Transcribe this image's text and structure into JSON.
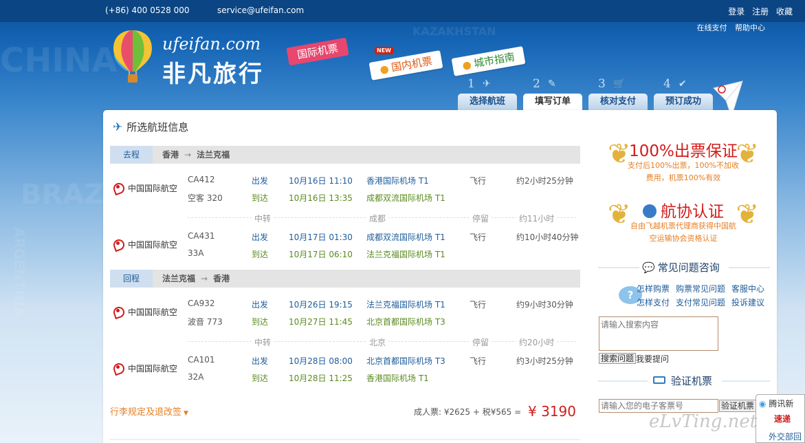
{
  "topbar": {
    "phone": "(+86) 400 0528 000",
    "email": "service@ufeifan.com",
    "links": [
      "登录",
      "注册",
      "收藏"
    ],
    "sublinks": [
      "在线支付",
      "帮助中心"
    ]
  },
  "logo": {
    "url": "ufeifan.com",
    "name": "非凡旅行"
  },
  "nav": {
    "intl": "国际机票",
    "domestic": "国内机票",
    "city": "城市指南",
    "new_badge": "NEW"
  },
  "steps": [
    {
      "num": "1",
      "label": "选择航班"
    },
    {
      "num": "2",
      "label": "填写订单"
    },
    {
      "num": "3",
      "label": "核对支付"
    },
    {
      "num": "4",
      "label": "预订成功"
    }
  ],
  "bg_words": [
    "ARGENTINA",
    "BRAZIL",
    "KAZAKHSTAN",
    "CHINA"
  ],
  "section_title": "所选航班信息",
  "outbound": {
    "tag": "去程",
    "from": "香港",
    "to": "法兰克福",
    "arrow": "→",
    "seg1": {
      "airline": "中国国际航空",
      "flight": "CA412",
      "aircraft": "空客 320",
      "dep_label": "出发",
      "dep_time": "10月16日 11:10",
      "dep_airport": "香港国际机场 T1",
      "arr_label": "到达",
      "arr_time": "10月16日 13:35",
      "arr_airport": "成都双流国际机场 T1",
      "type": "飞行",
      "duration": "约2小时25分钟"
    },
    "transfer": {
      "label": "中转",
      "city": "成都",
      "stay": "停留",
      "stay_time": "约11小时"
    },
    "seg2": {
      "airline": "中国国际航空",
      "flight": "CA431",
      "aircraft": "33A",
      "dep_label": "出发",
      "dep_time": "10月17日 01:30",
      "dep_airport": "成都双流国际机场 T1",
      "arr_label": "到达",
      "arr_time": "10月17日 06:10",
      "arr_airport": "法兰克福国际机场 T1",
      "type": "飞行",
      "duration": "约10小时40分钟"
    }
  },
  "return": {
    "tag": "回程",
    "from": "法兰克福",
    "to": "香港",
    "arrow": "→",
    "seg1": {
      "airline": "中国国际航空",
      "flight": "CA932",
      "aircraft": "波音 773",
      "dep_label": "出发",
      "dep_time": "10月26日 19:15",
      "dep_airport": "法兰克福国际机场 T1",
      "arr_label": "到达",
      "arr_time": "10月27日 11:45",
      "arr_airport": "北京首都国际机场 T3",
      "type": "飞行",
      "duration": "约9小时30分钟"
    },
    "transfer": {
      "label": "中转",
      "city": "北京",
      "stay": "停留",
      "stay_time": "约20小时"
    },
    "seg2": {
      "airline": "中国国际航空",
      "flight": "CA101",
      "aircraft": "32A",
      "dep_label": "出发",
      "dep_time": "10月28日 08:00",
      "dep_airport": "北京首都国际机场 T3",
      "arr_label": "到达",
      "arr_time": "10月28日 11:25",
      "arr_airport": "香港国际机场 T1",
      "type": "飞行",
      "duration": "约3小时25分钟"
    }
  },
  "rules_link": "行李规定及退改签",
  "price": {
    "label": "成人票:",
    "base": "¥2625",
    "plus": "+",
    "tax": "税¥565",
    "eq": "=",
    "total_sym": "¥",
    "total": "3190"
  },
  "sidebar": {
    "guarantee": {
      "title": "100%出票保证",
      "desc": "支付后100%出票，100%不加收费用，机票100%有效"
    },
    "cert": {
      "title": "航协认证",
      "desc": "自由飞越机票代理商获得中国航空运输协会资格认证"
    },
    "faq_title": "常见问题咨询",
    "faq_links": [
      "怎样购票",
      "购票常见问题",
      "客服中心",
      "怎样支付",
      "支付常见问题",
      "投诉建议"
    ],
    "faq_icon": "?",
    "search_placeholder": "请输入搜索内容",
    "search_btn": "搜索问题",
    "ask": "我要提问",
    "verify_title": "验证机票",
    "ticket_placeholder": "请输入您的电子客票号",
    "verify_btn": "验证机票"
  },
  "popup": {
    "line1": "腾讯新",
    "line2": "速递",
    "line3": "外交部回"
  },
  "watermark": "eLvTing.net"
}
